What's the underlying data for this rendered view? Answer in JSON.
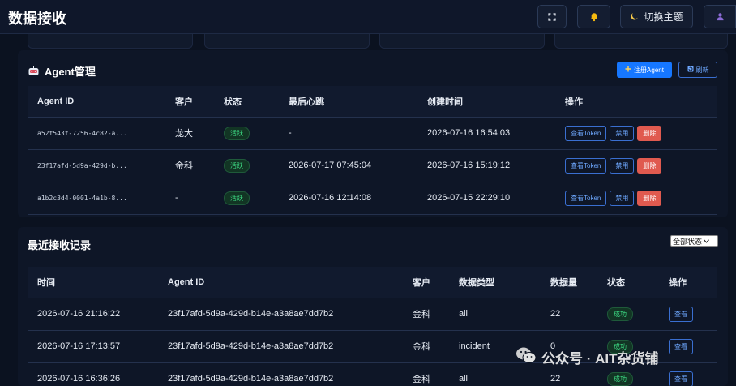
{
  "header": {
    "title": "数据接收",
    "theme_label": "切换主题"
  },
  "agent_section": {
    "title": "Agent管理",
    "register_label": "注册Agent",
    "refresh_label": "刷新",
    "columns": [
      "Agent ID",
      "客户",
      "状态",
      "最后心跳",
      "创建时间",
      "操作"
    ],
    "rows": [
      {
        "id": "a52f543f-7256-4c82-a...",
        "customer": "龙大",
        "status": "活跃",
        "heartbeat": "-",
        "created": "2026-07-16 16:54:03",
        "view": "查看Token",
        "disable": "禁用",
        "delete": "删除"
      },
      {
        "id": "23f17afd-5d9a-429d-b...",
        "customer": "金科",
        "status": "活跃",
        "heartbeat": "2026-07-17 07:45:04",
        "created": "2026-07-16 15:19:12",
        "view": "查看Token",
        "disable": "禁用",
        "delete": "删除"
      },
      {
        "id": "a1b2c3d4-0001-4a1b-8...",
        "customer": "-",
        "status": "活跃",
        "heartbeat": "2026-07-16 12:14:08",
        "created": "2026-07-15 22:29:10",
        "view": "查看Token",
        "disable": "禁用",
        "delete": "删除"
      }
    ]
  },
  "records_section": {
    "title": "最近接收记录",
    "filter": "全部状态",
    "columns": [
      "时间",
      "Agent ID",
      "客户",
      "数据类型",
      "数据量",
      "状态",
      "操作"
    ],
    "rows": [
      {
        "time": "2026-07-16 21:16:22",
        "id": "23f17afd-5d9a-429d-b14e-a3a8ae7dd7b2",
        "customer": "金科",
        "type": "all",
        "count": "22",
        "status": "成功",
        "action": "查看"
      },
      {
        "time": "2026-07-16 17:13:57",
        "id": "23f17afd-5d9a-429d-b14e-a3a8ae7dd7b2",
        "customer": "金科",
        "type": "incident",
        "count": "0",
        "status": "成功",
        "action": "查看"
      },
      {
        "time": "2026-07-16 16:36:26",
        "id": "23f17afd-5d9a-429d-b14e-a3a8ae7dd7b2",
        "customer": "金科",
        "type": "all",
        "count": "22",
        "status": "成功",
        "action": "查看"
      }
    ]
  },
  "watermark": "公众号 · AIT杂货铺",
  "colors": {
    "background": "#0b1220",
    "primary": "#1677ff",
    "danger": "#e05a4f",
    "success": "#3ddc84"
  },
  "icons": [
    "fullscreen-icon",
    "bell-icon",
    "moon-icon",
    "user-icon",
    "robot-icon",
    "plus-icon",
    "refresh-icon",
    "wechat-icon"
  ]
}
